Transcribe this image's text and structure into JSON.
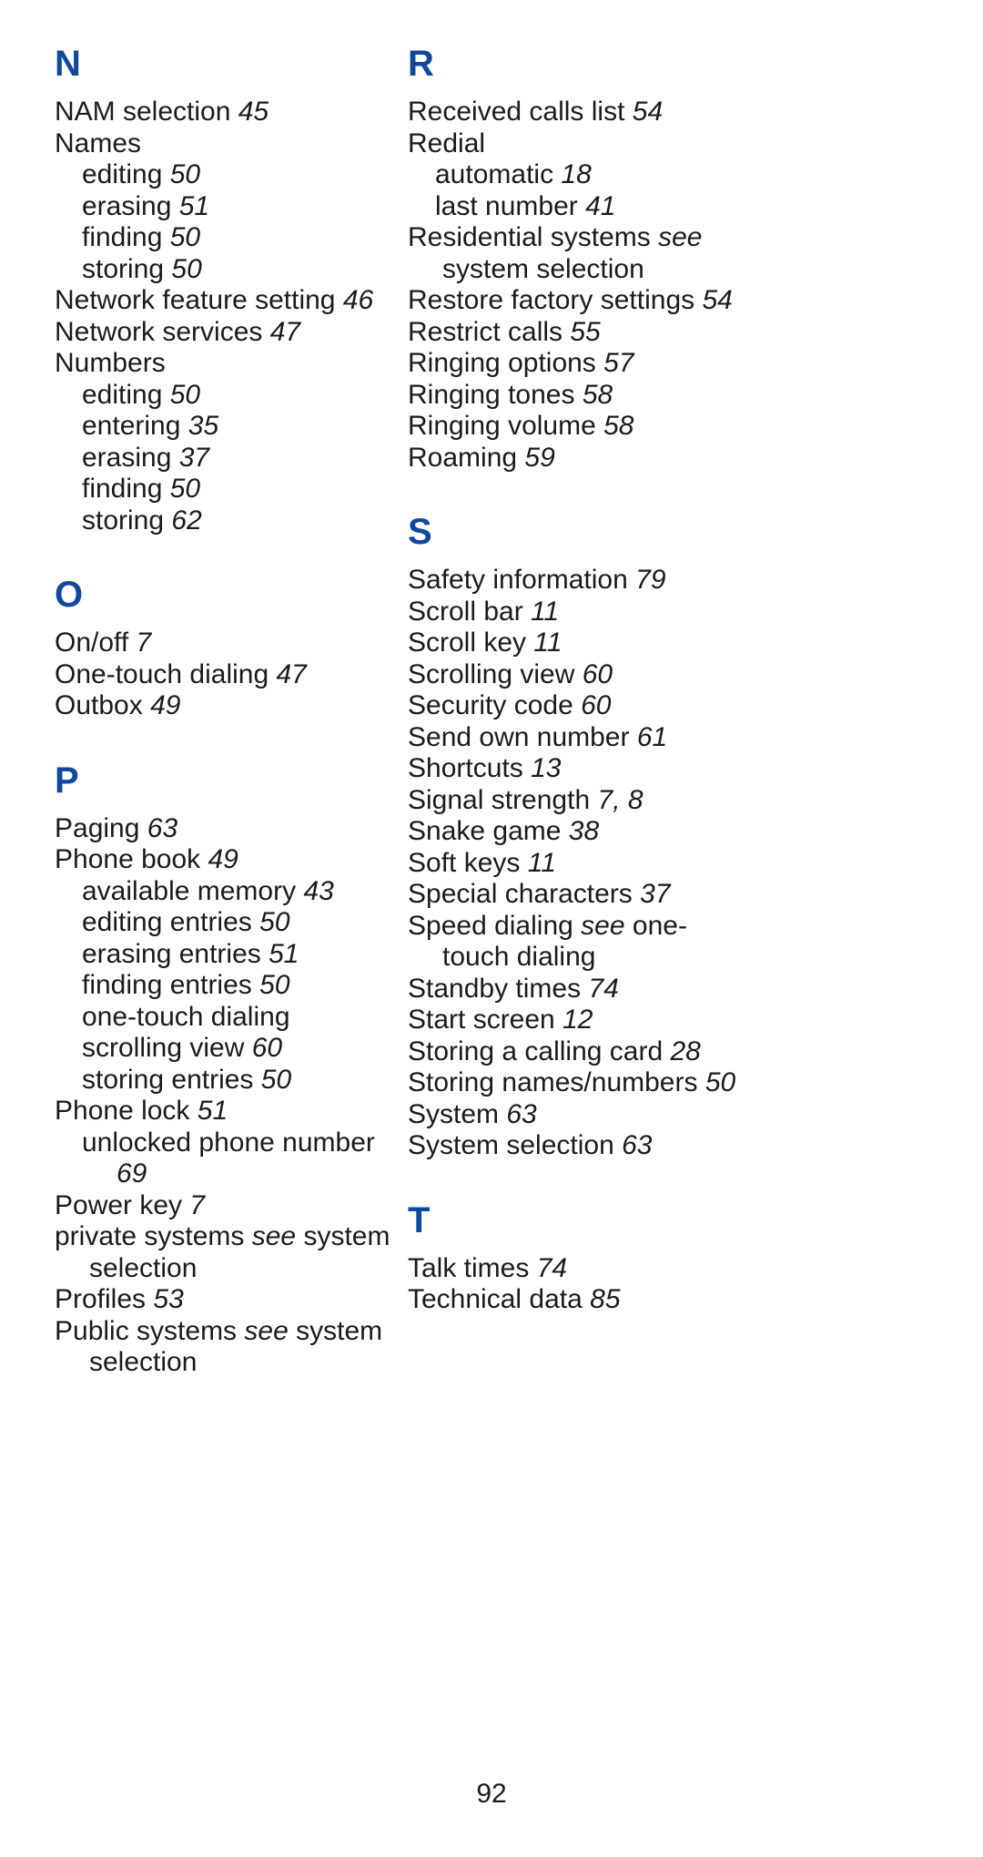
{
  "document": {
    "type": "index",
    "folio": "92",
    "heading_color": "#10489b",
    "text_color": "#1b1b1b",
    "background": "#ffffff"
  },
  "columns": [
    {
      "id": "left",
      "sections": [
        {
          "letter": "N",
          "entries": [
            {
              "level": 1,
              "text": "NAM selection",
              "page": "45"
            },
            {
              "level": 1,
              "text": "Names",
              "page": ""
            },
            {
              "level": 2,
              "text": "editing",
              "page": "50"
            },
            {
              "level": 2,
              "text": "erasing",
              "page": "51"
            },
            {
              "level": 2,
              "text": "finding",
              "page": "50"
            },
            {
              "level": 2,
              "text": "storing",
              "page": "50"
            },
            {
              "level": 1,
              "text": "Network feature setting",
              "page": "46"
            },
            {
              "level": 1,
              "text": "Network services",
              "page": "47"
            },
            {
              "level": 1,
              "text": "Numbers",
              "page": ""
            },
            {
              "level": 2,
              "text": "editing",
              "page": "50"
            },
            {
              "level": 2,
              "text": "entering",
              "page": "35"
            },
            {
              "level": 2,
              "text": "erasing",
              "page": "37"
            },
            {
              "level": 2,
              "text": "finding",
              "page": "50"
            },
            {
              "level": 2,
              "text": "storing",
              "page": "62"
            }
          ]
        },
        {
          "letter": "O",
          "entries": [
            {
              "level": 1,
              "text": "On/off",
              "page": "7"
            },
            {
              "level": 1,
              "text": "One-touch dialing",
              "page": "47"
            },
            {
              "level": 1,
              "text": "Outbox",
              "page": "49"
            }
          ]
        },
        {
          "letter": "P",
          "entries": [
            {
              "level": 1,
              "text": "Paging",
              "page": "63"
            },
            {
              "level": 1,
              "text": "Phone book",
              "page": "49"
            },
            {
              "level": 2,
              "text": "available memory",
              "page": "43"
            },
            {
              "level": 2,
              "text": "editing entries",
              "page": "50"
            },
            {
              "level": 2,
              "text": "erasing entries",
              "page": "51"
            },
            {
              "level": 2,
              "text": "finding entries",
              "page": "50"
            },
            {
              "level": 2,
              "text": "one-touch dialing",
              "page": ""
            },
            {
              "level": 2,
              "text": "scrolling view",
              "page": "60"
            },
            {
              "level": 2,
              "text": "storing entries",
              "page": "50"
            },
            {
              "level": 1,
              "text": "Phone lock",
              "page": "51"
            },
            {
              "level": 2,
              "text": "unlocked phone number",
              "page": "69",
              "hang": true
            },
            {
              "level": 1,
              "text": "Power key",
              "page": "7"
            },
            {
              "level": 1,
              "text": "private systems",
              "see": "see",
              "see_target": "system selection",
              "hang": true
            },
            {
              "level": 1,
              "text": "Profiles",
              "page": "53"
            },
            {
              "level": 1,
              "text": "Public systems",
              "see": "see",
              "see_target": "system selection",
              "hang": true
            }
          ]
        }
      ]
    },
    {
      "id": "right",
      "sections": [
        {
          "letter": "R",
          "entries": [
            {
              "level": 1,
              "text": "Received calls list",
              "page": "54"
            },
            {
              "level": 1,
              "text": "Redial",
              "page": ""
            },
            {
              "level": 2,
              "text": "automatic",
              "page": "18"
            },
            {
              "level": 2,
              "text": "last number",
              "page": "41"
            },
            {
              "level": 1,
              "text": "Residential systems",
              "see": "see",
              "see_target": "system selection",
              "hang": true
            },
            {
              "level": 1,
              "text": "Restore factory settings",
              "page": "54"
            },
            {
              "level": 1,
              "text": "Restrict calls",
              "page": "55"
            },
            {
              "level": 1,
              "text": "Ringing options",
              "page": "57"
            },
            {
              "level": 1,
              "text": "Ringing tones",
              "page": "58"
            },
            {
              "level": 1,
              "text": "Ringing volume",
              "page": "58"
            },
            {
              "level": 1,
              "text": "Roaming",
              "page": "59"
            }
          ]
        },
        {
          "letter": "S",
          "entries": [
            {
              "level": 1,
              "text": "Safety information",
              "page": "79"
            },
            {
              "level": 1,
              "text": "Scroll bar",
              "page": "11"
            },
            {
              "level": 1,
              "text": "Scroll key",
              "page": "11"
            },
            {
              "level": 1,
              "text": "Scrolling view",
              "page": "60"
            },
            {
              "level": 1,
              "text": "Security code",
              "page": "60"
            },
            {
              "level": 1,
              "text": "Send own number",
              "page": "61"
            },
            {
              "level": 1,
              "text": "Shortcuts",
              "page": "13"
            },
            {
              "level": 1,
              "text": "Signal strength",
              "page": "7, 8"
            },
            {
              "level": 1,
              "text": "Snake game",
              "page": "38"
            },
            {
              "level": 1,
              "text": "Soft keys",
              "page": "11"
            },
            {
              "level": 1,
              "text": "Special characters",
              "page": "37"
            },
            {
              "level": 1,
              "text": "Speed dialing",
              "see": "see",
              "see_target": "one-touch dialing",
              "hang": true
            },
            {
              "level": 1,
              "text": "Standby times",
              "page": "74"
            },
            {
              "level": 1,
              "text": "Start screen",
              "page": "12"
            },
            {
              "level": 1,
              "text": "Storing a calling card",
              "page": "28"
            },
            {
              "level": 1,
              "text": "Storing names/numbers",
              "page": "50"
            },
            {
              "level": 1,
              "text": "System",
              "page": "63"
            },
            {
              "level": 1,
              "text": "System selection",
              "page": "63"
            }
          ]
        },
        {
          "letter": "T",
          "entries": [
            {
              "level": 1,
              "text": "Talk times",
              "page": "74"
            },
            {
              "level": 1,
              "text": "Technical data",
              "page": "85"
            }
          ]
        }
      ]
    }
  ]
}
